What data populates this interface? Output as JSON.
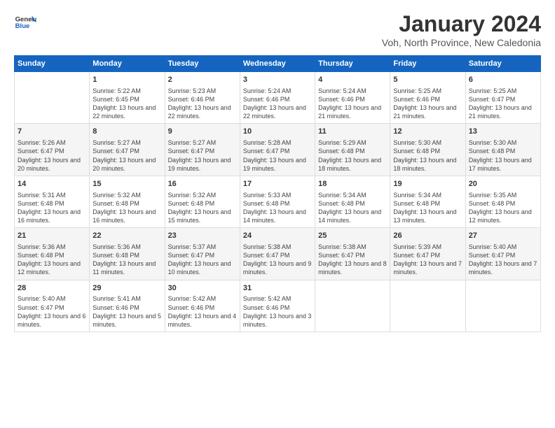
{
  "logo": {
    "general": "General",
    "blue": "Blue"
  },
  "header": {
    "title": "January 2024",
    "subtitle": "Voh, North Province, New Caledonia"
  },
  "weekdays": [
    "Sunday",
    "Monday",
    "Tuesday",
    "Wednesday",
    "Thursday",
    "Friday",
    "Saturday"
  ],
  "weeks": [
    [
      {
        "day": "",
        "sunrise": "",
        "sunset": "",
        "daylight": ""
      },
      {
        "day": "1",
        "sunrise": "Sunrise: 5:22 AM",
        "sunset": "Sunset: 6:45 PM",
        "daylight": "Daylight: 13 hours and 22 minutes."
      },
      {
        "day": "2",
        "sunrise": "Sunrise: 5:23 AM",
        "sunset": "Sunset: 6:46 PM",
        "daylight": "Daylight: 13 hours and 22 minutes."
      },
      {
        "day": "3",
        "sunrise": "Sunrise: 5:24 AM",
        "sunset": "Sunset: 6:46 PM",
        "daylight": "Daylight: 13 hours and 22 minutes."
      },
      {
        "day": "4",
        "sunrise": "Sunrise: 5:24 AM",
        "sunset": "Sunset: 6:46 PM",
        "daylight": "Daylight: 13 hours and 21 minutes."
      },
      {
        "day": "5",
        "sunrise": "Sunrise: 5:25 AM",
        "sunset": "Sunset: 6:46 PM",
        "daylight": "Daylight: 13 hours and 21 minutes."
      },
      {
        "day": "6",
        "sunrise": "Sunrise: 5:25 AM",
        "sunset": "Sunset: 6:47 PM",
        "daylight": "Daylight: 13 hours and 21 minutes."
      }
    ],
    [
      {
        "day": "7",
        "sunrise": "Sunrise: 5:26 AM",
        "sunset": "Sunset: 6:47 PM",
        "daylight": "Daylight: 13 hours and 20 minutes."
      },
      {
        "day": "8",
        "sunrise": "Sunrise: 5:27 AM",
        "sunset": "Sunset: 6:47 PM",
        "daylight": "Daylight: 13 hours and 20 minutes."
      },
      {
        "day": "9",
        "sunrise": "Sunrise: 5:27 AM",
        "sunset": "Sunset: 6:47 PM",
        "daylight": "Daylight: 13 hours and 19 minutes."
      },
      {
        "day": "10",
        "sunrise": "Sunrise: 5:28 AM",
        "sunset": "Sunset: 6:47 PM",
        "daylight": "Daylight: 13 hours and 19 minutes."
      },
      {
        "day": "11",
        "sunrise": "Sunrise: 5:29 AM",
        "sunset": "Sunset: 6:48 PM",
        "daylight": "Daylight: 13 hours and 18 minutes."
      },
      {
        "day": "12",
        "sunrise": "Sunrise: 5:30 AM",
        "sunset": "Sunset: 6:48 PM",
        "daylight": "Daylight: 13 hours and 18 minutes."
      },
      {
        "day": "13",
        "sunrise": "Sunrise: 5:30 AM",
        "sunset": "Sunset: 6:48 PM",
        "daylight": "Daylight: 13 hours and 17 minutes."
      }
    ],
    [
      {
        "day": "14",
        "sunrise": "Sunrise: 5:31 AM",
        "sunset": "Sunset: 6:48 PM",
        "daylight": "Daylight: 13 hours and 16 minutes."
      },
      {
        "day": "15",
        "sunrise": "Sunrise: 5:32 AM",
        "sunset": "Sunset: 6:48 PM",
        "daylight": "Daylight: 13 hours and 16 minutes."
      },
      {
        "day": "16",
        "sunrise": "Sunrise: 5:32 AM",
        "sunset": "Sunset: 6:48 PM",
        "daylight": "Daylight: 13 hours and 15 minutes."
      },
      {
        "day": "17",
        "sunrise": "Sunrise: 5:33 AM",
        "sunset": "Sunset: 6:48 PM",
        "daylight": "Daylight: 13 hours and 14 minutes."
      },
      {
        "day": "18",
        "sunrise": "Sunrise: 5:34 AM",
        "sunset": "Sunset: 6:48 PM",
        "daylight": "Daylight: 13 hours and 14 minutes."
      },
      {
        "day": "19",
        "sunrise": "Sunrise: 5:34 AM",
        "sunset": "Sunset: 6:48 PM",
        "daylight": "Daylight: 13 hours and 13 minutes."
      },
      {
        "day": "20",
        "sunrise": "Sunrise: 5:35 AM",
        "sunset": "Sunset: 6:48 PM",
        "daylight": "Daylight: 13 hours and 12 minutes."
      }
    ],
    [
      {
        "day": "21",
        "sunrise": "Sunrise: 5:36 AM",
        "sunset": "Sunset: 6:48 PM",
        "daylight": "Daylight: 13 hours and 12 minutes."
      },
      {
        "day": "22",
        "sunrise": "Sunrise: 5:36 AM",
        "sunset": "Sunset: 6:48 PM",
        "daylight": "Daylight: 13 hours and 11 minutes."
      },
      {
        "day": "23",
        "sunrise": "Sunrise: 5:37 AM",
        "sunset": "Sunset: 6:47 PM",
        "daylight": "Daylight: 13 hours and 10 minutes."
      },
      {
        "day": "24",
        "sunrise": "Sunrise: 5:38 AM",
        "sunset": "Sunset: 6:47 PM",
        "daylight": "Daylight: 13 hours and 9 minutes."
      },
      {
        "day": "25",
        "sunrise": "Sunrise: 5:38 AM",
        "sunset": "Sunset: 6:47 PM",
        "daylight": "Daylight: 13 hours and 8 minutes."
      },
      {
        "day": "26",
        "sunrise": "Sunrise: 5:39 AM",
        "sunset": "Sunset: 6:47 PM",
        "daylight": "Daylight: 13 hours and 7 minutes."
      },
      {
        "day": "27",
        "sunrise": "Sunrise: 5:40 AM",
        "sunset": "Sunset: 6:47 PM",
        "daylight": "Daylight: 13 hours and 7 minutes."
      }
    ],
    [
      {
        "day": "28",
        "sunrise": "Sunrise: 5:40 AM",
        "sunset": "Sunset: 6:47 PM",
        "daylight": "Daylight: 13 hours and 6 minutes."
      },
      {
        "day": "29",
        "sunrise": "Sunrise: 5:41 AM",
        "sunset": "Sunset: 6:46 PM",
        "daylight": "Daylight: 13 hours and 5 minutes."
      },
      {
        "day": "30",
        "sunrise": "Sunrise: 5:42 AM",
        "sunset": "Sunset: 6:46 PM",
        "daylight": "Daylight: 13 hours and 4 minutes."
      },
      {
        "day": "31",
        "sunrise": "Sunrise: 5:42 AM",
        "sunset": "Sunset: 6:46 PM",
        "daylight": "Daylight: 13 hours and 3 minutes."
      },
      {
        "day": "",
        "sunrise": "",
        "sunset": "",
        "daylight": ""
      },
      {
        "day": "",
        "sunrise": "",
        "sunset": "",
        "daylight": ""
      },
      {
        "day": "",
        "sunrise": "",
        "sunset": "",
        "daylight": ""
      }
    ]
  ]
}
